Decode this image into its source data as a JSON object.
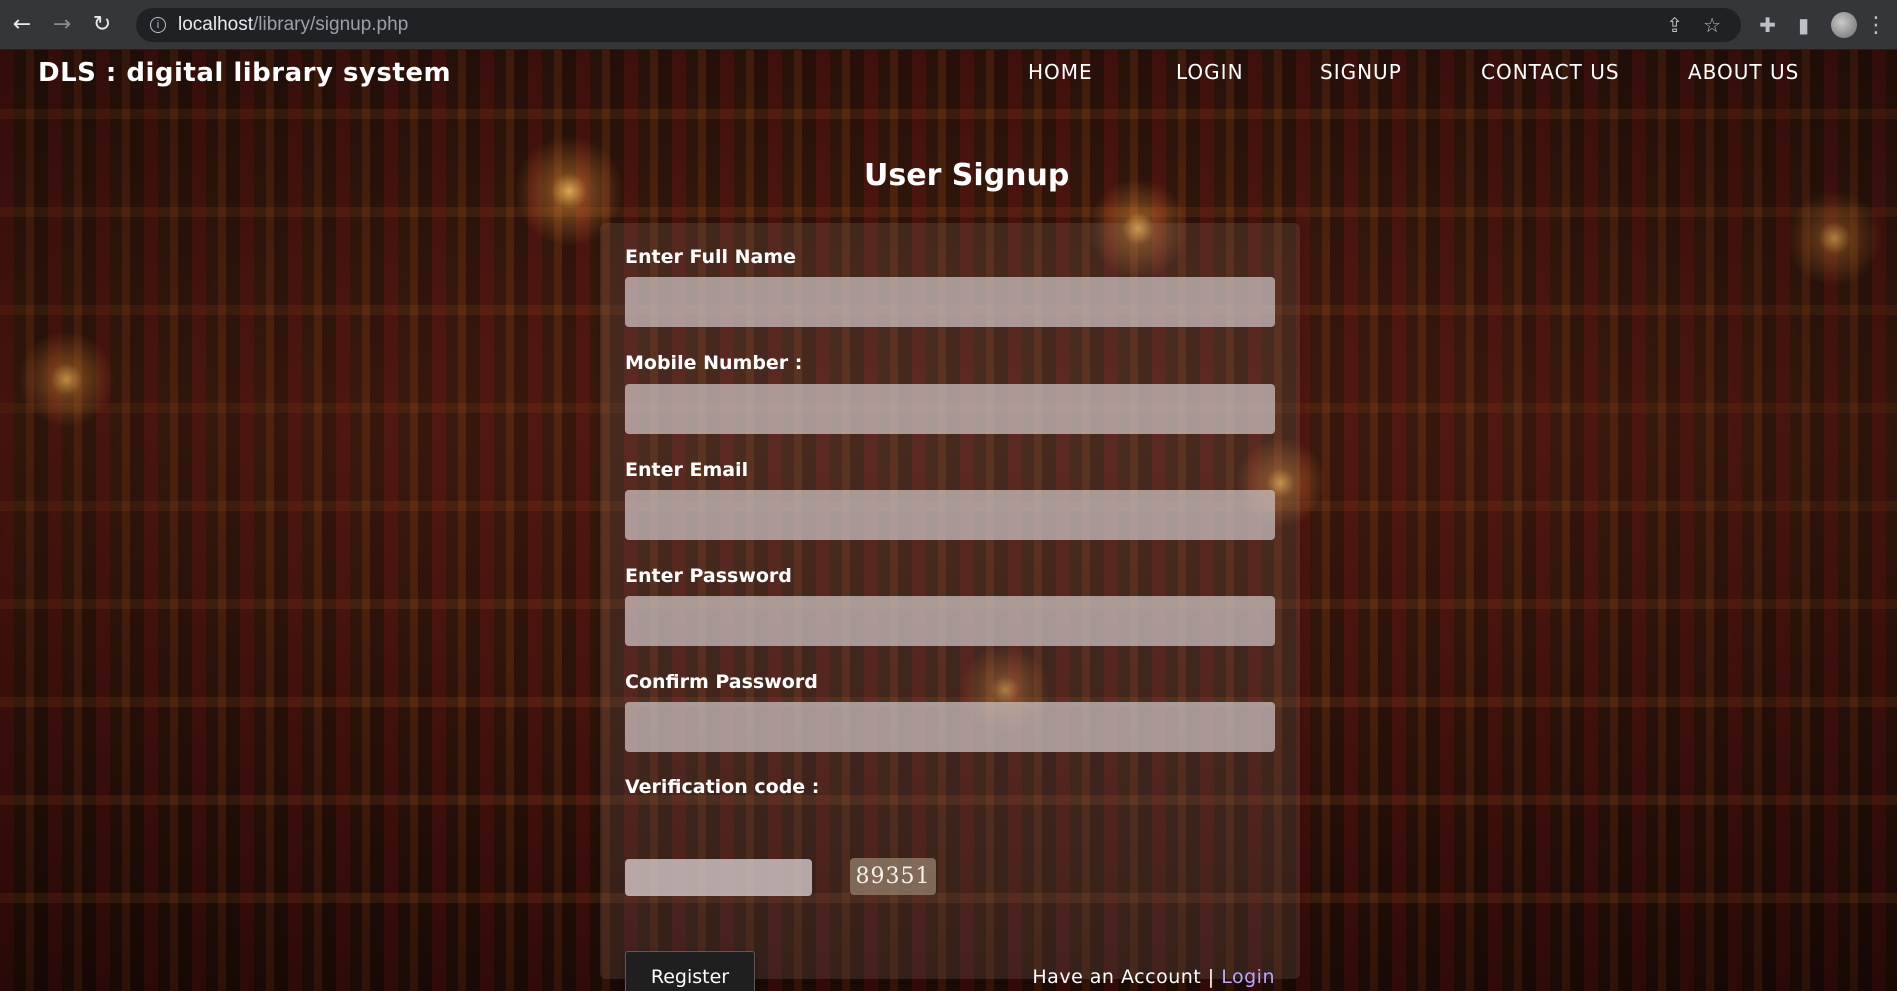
{
  "browser": {
    "url_host": "localhost",
    "url_path": "/library/signup.php"
  },
  "navbar": {
    "brand": "DLS : digital library system",
    "items": [
      {
        "label": "HOME"
      },
      {
        "label": "LOGIN"
      },
      {
        "label": "SIGNUP"
      },
      {
        "label": "CONTACT US"
      },
      {
        "label": "ABOUT US"
      }
    ]
  },
  "form": {
    "title": "User Signup",
    "fields": [
      {
        "label": "Enter Full Name",
        "value": ""
      },
      {
        "label": "Mobile Number :",
        "value": ""
      },
      {
        "label": "Enter Email",
        "value": ""
      },
      {
        "label": "Enter Password",
        "value": ""
      },
      {
        "label": "Confirm Password",
        "value": ""
      }
    ],
    "verification": {
      "label": "Verification code :",
      "value": "",
      "code": "89351"
    },
    "register_label": "Register",
    "account_text": "Have an Account |",
    "login_link": "Login"
  }
}
